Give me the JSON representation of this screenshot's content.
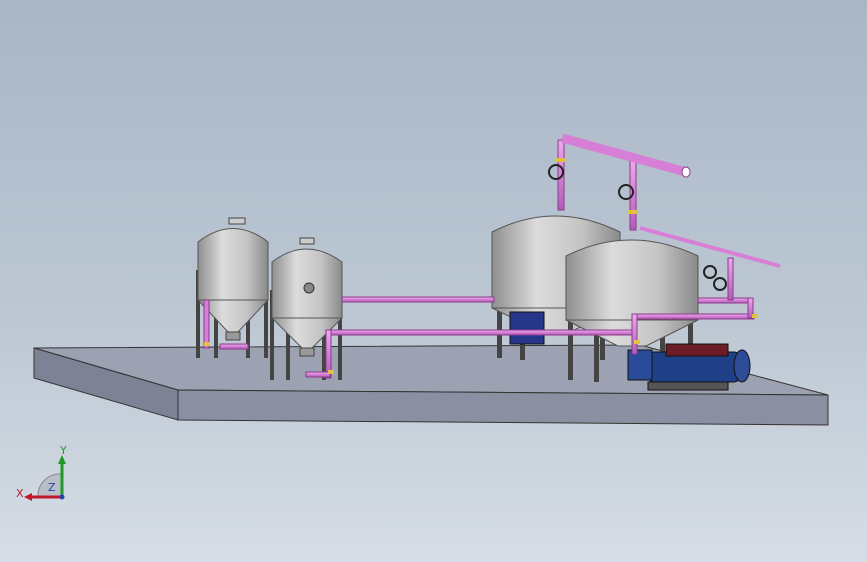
{
  "viewport": {
    "background_top": "#a9b6c6",
    "background_bottom": "#d6dde5"
  },
  "colors": {
    "pipe": "#d77fd6",
    "pipe_dark": "#a04aa3",
    "tank": "#c9c9c9",
    "tank_shadow": "#8f8f8f",
    "base": "#8e93a6",
    "base_top": "#9da2b3",
    "motor": "#1f3f86",
    "valve_brass": "#e0c243"
  },
  "triad": {
    "x_label": "X",
    "y_label": "Y",
    "z_label": "Z",
    "x_color": "#c0182a",
    "y_color": "#1f9a2a",
    "z_color": "#2b3fb0"
  },
  "icons": [
    "coordinate-triad-icon"
  ]
}
